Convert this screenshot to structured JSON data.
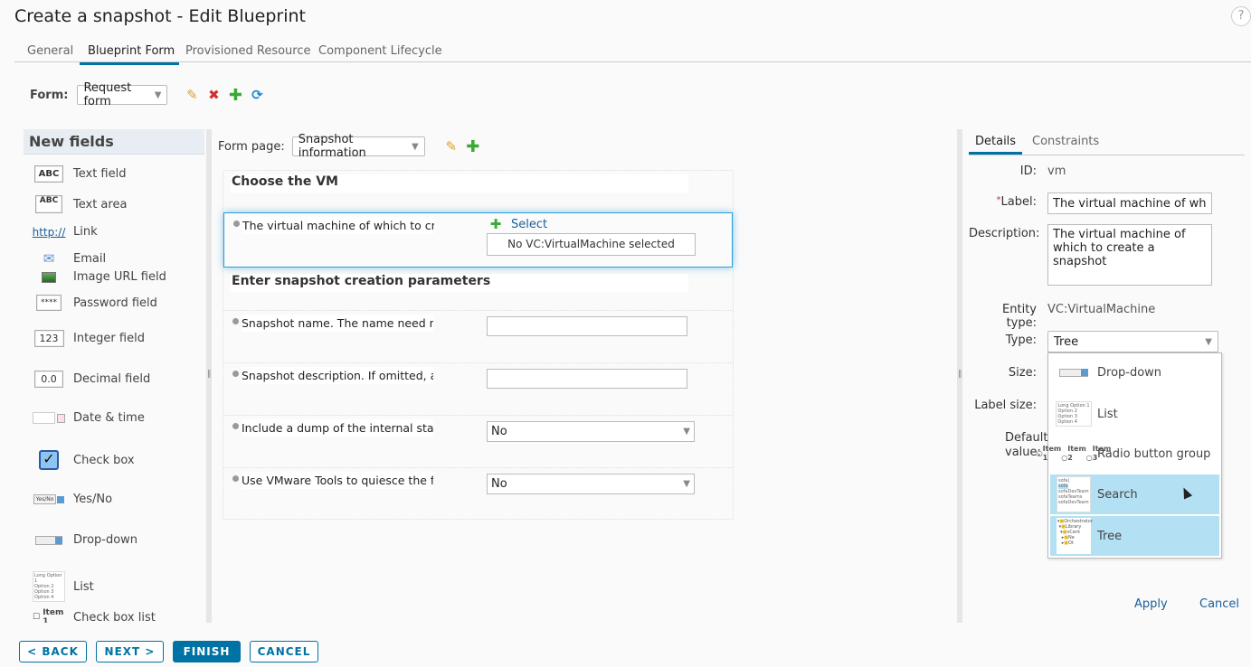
{
  "window": {
    "title": "Create a snapshot - Edit Blueprint",
    "help_label": "?"
  },
  "tabs": [
    {
      "label": "General",
      "active": false
    },
    {
      "label": "Blueprint Form",
      "active": true
    },
    {
      "label": "Provisioned Resource",
      "active": false
    },
    {
      "label": "Component Lifecycle",
      "active": false
    }
  ],
  "form_bar": {
    "label": "Form:",
    "selected": "Request form",
    "icons": [
      "edit-icon",
      "delete-icon",
      "add-icon",
      "refresh-icon"
    ]
  },
  "palette": {
    "title": "New fields",
    "items": [
      {
        "label": "Text field",
        "icon": "ABC"
      },
      {
        "label": "Text area",
        "icon": "ABC"
      },
      {
        "label": "Link",
        "icon": "http://"
      },
      {
        "label": "Email",
        "icon": "email"
      },
      {
        "label": "Image URL field",
        "icon": "image"
      },
      {
        "label": "Password field",
        "icon": "****"
      },
      {
        "label": "Integer field",
        "icon": "123"
      },
      {
        "label": "Decimal field",
        "icon": "0.0"
      },
      {
        "label": "Date & time",
        "icon": "date"
      },
      {
        "label": "Check box",
        "icon": "checkbox"
      },
      {
        "label": "Yes/No",
        "icon": "Yes/No"
      },
      {
        "label": "Drop-down",
        "icon": "dropdown"
      },
      {
        "label": "List",
        "icon": "list"
      },
      {
        "label": "Check box list",
        "icon": "Item 1"
      }
    ]
  },
  "form_page": {
    "label": "Form page:",
    "selected": "Snapshot information"
  },
  "canvas": {
    "sections": [
      {
        "title": "Choose the VM"
      },
      {
        "title": "Enter snapshot creation parameters"
      }
    ],
    "fields": [
      {
        "label": "The virtual machine of which to create a snapshot",
        "control": "tree",
        "select_label": "Select",
        "empty_text": "No VC:VirtualMachine selected"
      },
      {
        "label": "Snapshot name. The name need not be unique",
        "control": "text",
        "value": ""
      },
      {
        "label": "Snapshot description. If omitted, a default",
        "control": "text",
        "value": ""
      },
      {
        "label": "Include a dump of the internal state of the VM",
        "control": "select",
        "value": "No"
      },
      {
        "label": "Use VMware Tools to quiesce the file system",
        "control": "select",
        "value": "No"
      }
    ]
  },
  "details": {
    "tabs": [
      {
        "label": "Details",
        "active": true
      },
      {
        "label": "Constraints",
        "active": false
      }
    ],
    "id_label": "ID:",
    "id_value": "vm",
    "label_label": "Label:",
    "label_value": "The virtual machine of which to create a snapshot",
    "description_label": "Description:",
    "description_value": "The virtual machine of which to create a snapshot",
    "entity_type_label": "Entity type:",
    "entity_type_value": "VC:VirtualMachine",
    "type_label": "Type:",
    "type_value": "Tree",
    "size_label": "Size:",
    "label_size_label": "Label size:",
    "default_value_label": "Default value:",
    "type_options": [
      {
        "label": "Drop-down",
        "highlighted": false
      },
      {
        "label": "List",
        "highlighted": false
      },
      {
        "label": "Radio button group",
        "highlighted": false,
        "items": [
          "Item 1",
          "Item 2",
          "Item 3"
        ]
      },
      {
        "label": "Search",
        "highlighted": true
      },
      {
        "label": "Tree",
        "highlighted": true
      }
    ],
    "apply_label": "Apply",
    "cancel_label": "Cancel"
  },
  "footer": {
    "back": "< BACK",
    "next": "NEXT >",
    "finish": "FINISH",
    "cancel": "CANCEL"
  }
}
